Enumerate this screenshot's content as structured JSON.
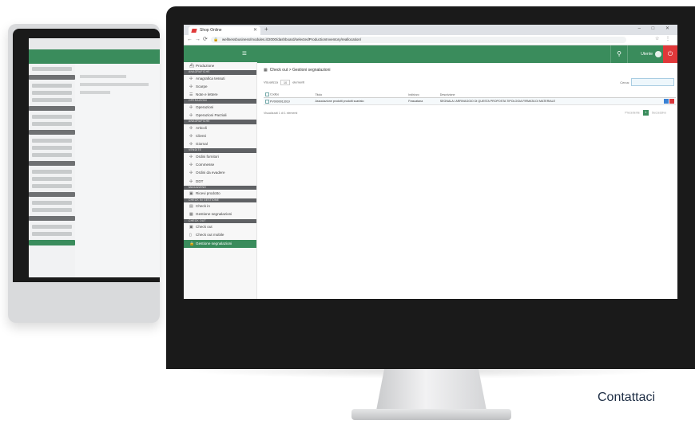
{
  "browser": {
    "tab_title": "Shop Online",
    "url": "wellnessbusiness/modules.it/2000/dashboard/selectedProductionInventory/reallocation/",
    "new_tab": "+",
    "window_controls": "– □ ✕"
  },
  "header": {
    "user_label": "Utente",
    "menu_icon": "hamburger-icon",
    "search_icon": "search-icon",
    "power_icon": "power-icon"
  },
  "sidebar": {
    "items": [
      {
        "type": "item",
        "label": "Produzione",
        "icon": "ship-icon"
      },
      {
        "type": "section",
        "label": "ANAGRAFICHE"
      },
      {
        "type": "item",
        "label": "Anagrafica tessuti",
        "icon": "plus-icon"
      },
      {
        "type": "item",
        "label": "Scarpe",
        "icon": "plus-icon"
      },
      {
        "type": "item",
        "label": "Note e lettere",
        "icon": "bars-icon"
      },
      {
        "type": "section",
        "label": "OPERAZIONI"
      },
      {
        "type": "item",
        "label": "Operazioni",
        "icon": "plus-icon"
      },
      {
        "type": "item",
        "label": "Operazioni Parziali",
        "icon": "plus-icon"
      },
      {
        "type": "section",
        "label": "ANAGRAFICHE"
      },
      {
        "type": "item",
        "label": "Articoli",
        "icon": "plus-icon"
      },
      {
        "type": "item",
        "label": "Clienti",
        "icon": "plus-icon"
      },
      {
        "type": "item",
        "label": "Giornal",
        "icon": "plus-icon"
      },
      {
        "type": "section",
        "label": "VENDITE"
      },
      {
        "type": "item",
        "label": "Ordini fornitori",
        "icon": "plus-icon"
      },
      {
        "type": "item",
        "label": "Commesse",
        "icon": "plus-icon"
      },
      {
        "type": "item",
        "label": "Ordini da evadere",
        "icon": "plus-icon"
      },
      {
        "type": "item",
        "label": "DDT",
        "icon": "plus-icon"
      },
      {
        "type": "section",
        "label": "MAGAZZINO"
      },
      {
        "type": "item",
        "label": "Ricevi prodotto",
        "icon": "box-icon"
      },
      {
        "type": "section",
        "label": "CHECK IN GESTIONE"
      },
      {
        "type": "item",
        "label": "Check in",
        "icon": "doc-icon"
      },
      {
        "type": "item",
        "label": "Gestione segnalazioni",
        "icon": "grid-icon"
      },
      {
        "type": "section",
        "label": "CHECK OUT"
      },
      {
        "type": "item",
        "label": "Check out",
        "icon": "box-icon"
      },
      {
        "type": "item",
        "label": "Check out mobile",
        "icon": "mobile-icon"
      },
      {
        "type": "item",
        "label": "Gestione segnalazioni",
        "icon": "lock-icon",
        "active": true
      }
    ]
  },
  "main": {
    "breadcrumb": "Check out > Gestioni segnalazioni",
    "show_label": "Visualizza",
    "show_value": "10",
    "show_suffix": "elementi",
    "search_label": "Cerca:",
    "columns": [
      "Codice",
      "Titolo",
      "Indirizzo",
      "Descrizione",
      ""
    ],
    "rows": [
      [
        "PV0000013019",
        "Associazione prodotti prodotti scartato",
        "Frascatana",
        "SEGNALA I ARRIVAGGIO DI QUESTA PROPOSTA TIPOLOGIA FIRMATA DI MATERIALE",
        ""
      ]
    ],
    "footer_info": "Visualizzati 1 di 1 elementi",
    "pager_prev": "Precedente",
    "pager_current": "1",
    "pager_next": "Successivo"
  },
  "cta": {
    "label": "Contattaci"
  }
}
